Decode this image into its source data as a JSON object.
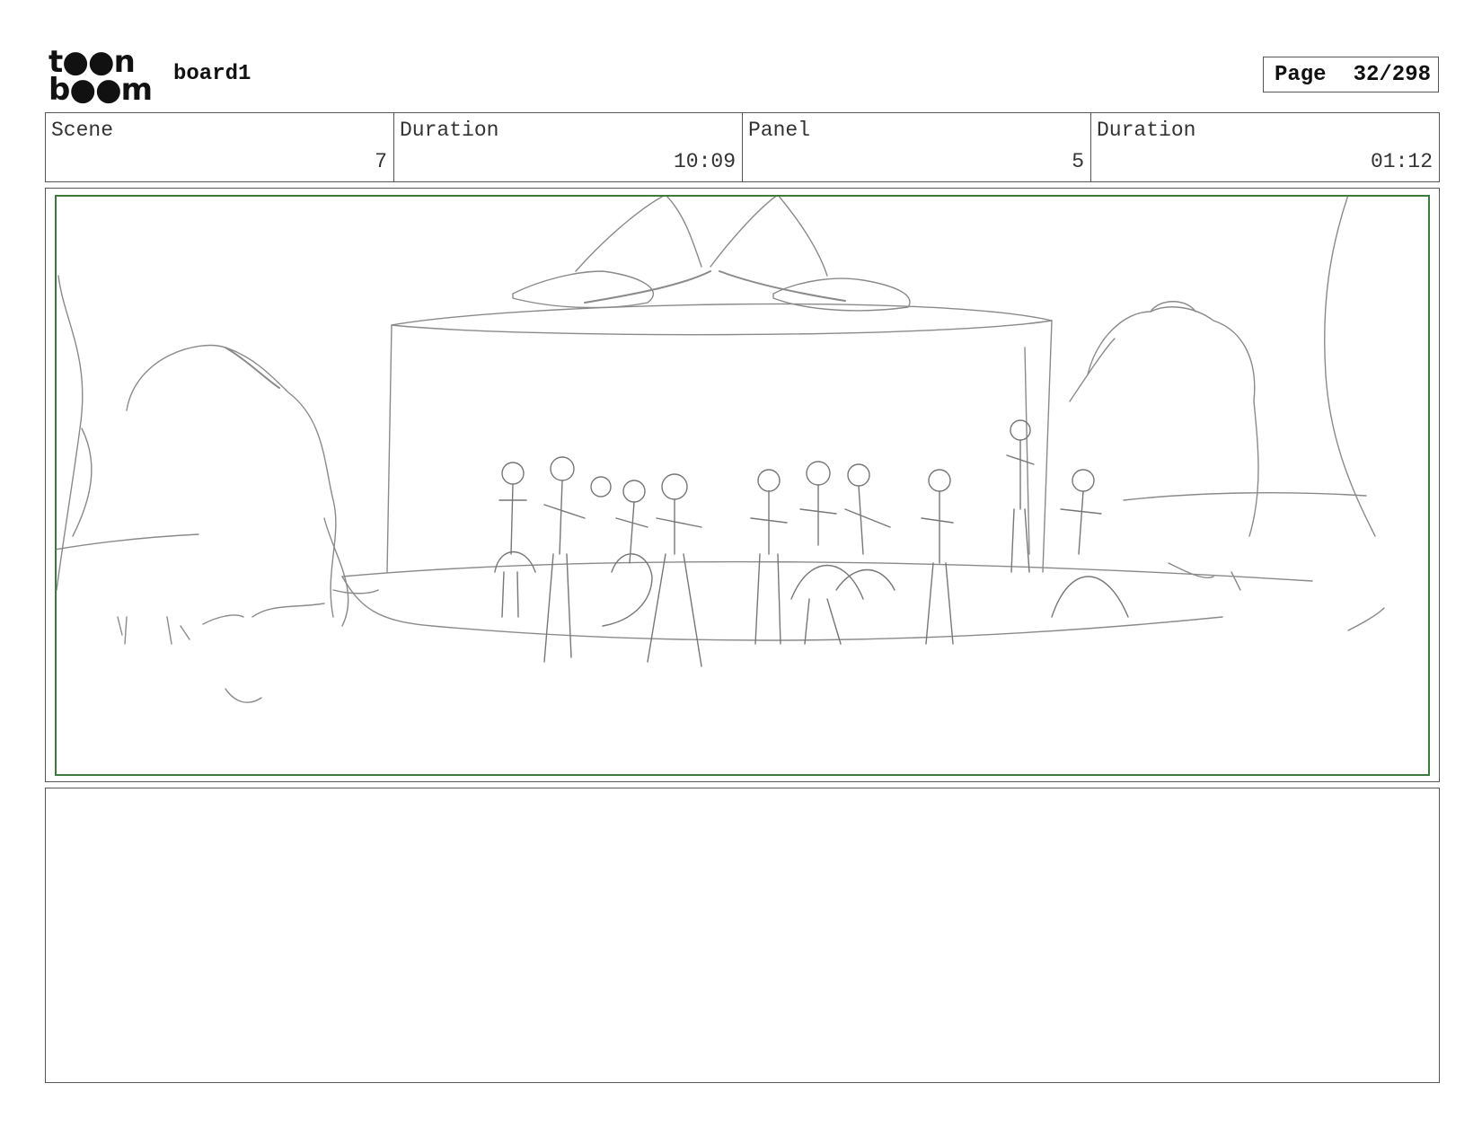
{
  "logo": {
    "line1": "t●●n",
    "line2": "b●●m"
  },
  "project_title": "board1",
  "page": {
    "label": "Page",
    "value": "32/298"
  },
  "info": [
    {
      "label": "Scene",
      "value": "7"
    },
    {
      "label": "Duration",
      "value": "10:09"
    },
    {
      "label": "Panel",
      "value": "5"
    },
    {
      "label": "Duration",
      "value": "01:12"
    }
  ],
  "colors": {
    "safe_area_border": "#3d7a3d",
    "frame_border": "#555555",
    "sketch_stroke": "#8a8a8a"
  }
}
